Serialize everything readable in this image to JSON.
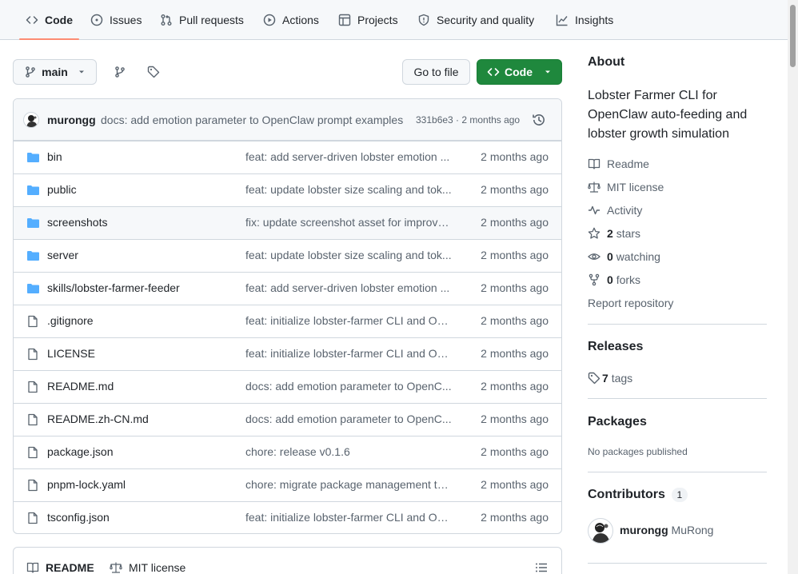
{
  "nav": {
    "items": [
      {
        "label": "Code",
        "icon": "code-icon"
      },
      {
        "label": "Issues",
        "icon": "issue-icon"
      },
      {
        "label": "Pull requests",
        "icon": "pull-request-icon"
      },
      {
        "label": "Actions",
        "icon": "play-icon"
      },
      {
        "label": "Projects",
        "icon": "table-icon"
      },
      {
        "label": "Security and quality",
        "icon": "shield-icon"
      },
      {
        "label": "Insights",
        "icon": "graph-icon"
      }
    ]
  },
  "toolbar": {
    "branch": "main",
    "go_to_file": "Go to file",
    "code_button": "Code"
  },
  "commit": {
    "author": "murongg",
    "message": "docs: add emotion parameter to OpenClaw prompt examples",
    "meta": "331b6e3 · 2 months ago"
  },
  "files": [
    {
      "name": "bin",
      "type": "dir",
      "message": "feat: add server-driven lobster emotion ...",
      "date": "2 months ago"
    },
    {
      "name": "public",
      "type": "dir",
      "message": "feat: update lobster size scaling and tok...",
      "date": "2 months ago"
    },
    {
      "name": "screenshots",
      "type": "dir",
      "message": "fix: update screenshot asset for improve...",
      "date": "2 months ago"
    },
    {
      "name": "server",
      "type": "dir",
      "message": "feat: update lobster size scaling and tok...",
      "date": "2 months ago"
    },
    {
      "name": "skills/lobster-farmer-feeder",
      "type": "dir",
      "message": "feat: add server-driven lobster emotion ...",
      "date": "2 months ago"
    },
    {
      "name": ".gitignore",
      "type": "file",
      "message": "feat: initialize lobster-farmer CLI and Op...",
      "date": "2 months ago"
    },
    {
      "name": "LICENSE",
      "type": "file",
      "message": "feat: initialize lobster-farmer CLI and Op...",
      "date": "2 months ago"
    },
    {
      "name": "README.md",
      "type": "file",
      "message": "docs: add emotion parameter to OpenC...",
      "date": "2 months ago"
    },
    {
      "name": "README.zh-CN.md",
      "type": "file",
      "message": "docs: add emotion parameter to OpenC...",
      "date": "2 months ago"
    },
    {
      "name": "package.json",
      "type": "file",
      "message": "chore: release v0.1.6",
      "date": "2 months ago"
    },
    {
      "name": "pnpm-lock.yaml",
      "type": "file",
      "message": "chore: migrate package management to...",
      "date": "2 months ago"
    },
    {
      "name": "tsconfig.json",
      "type": "file",
      "message": "feat: initialize lobster-farmer CLI and Op...",
      "date": "2 months ago"
    }
  ],
  "readme_tabs": {
    "readme": "README",
    "license": "MIT license"
  },
  "about": {
    "title": "About",
    "description": "Lobster Farmer CLI for OpenClaw auto-feeding and lobster growth simulation",
    "readme": "Readme",
    "license": "MIT license",
    "activity": "Activity",
    "stars_count": "2",
    "stars_label": "stars",
    "watching_count": "0",
    "watching_label": "watching",
    "forks_count": "0",
    "forks_label": "forks",
    "report": "Report repository"
  },
  "releases": {
    "title": "Releases",
    "tags_count": "7",
    "tags_label": "tags"
  },
  "packages": {
    "title": "Packages",
    "empty": "No packages published"
  },
  "contributors": {
    "title": "Contributors",
    "count": "1",
    "login": "murongg",
    "name": "MuRong"
  },
  "colors": {
    "accent_green": "#1f883d",
    "folder_blue": "#54aeff",
    "nav_underline": "#fd8c73"
  }
}
